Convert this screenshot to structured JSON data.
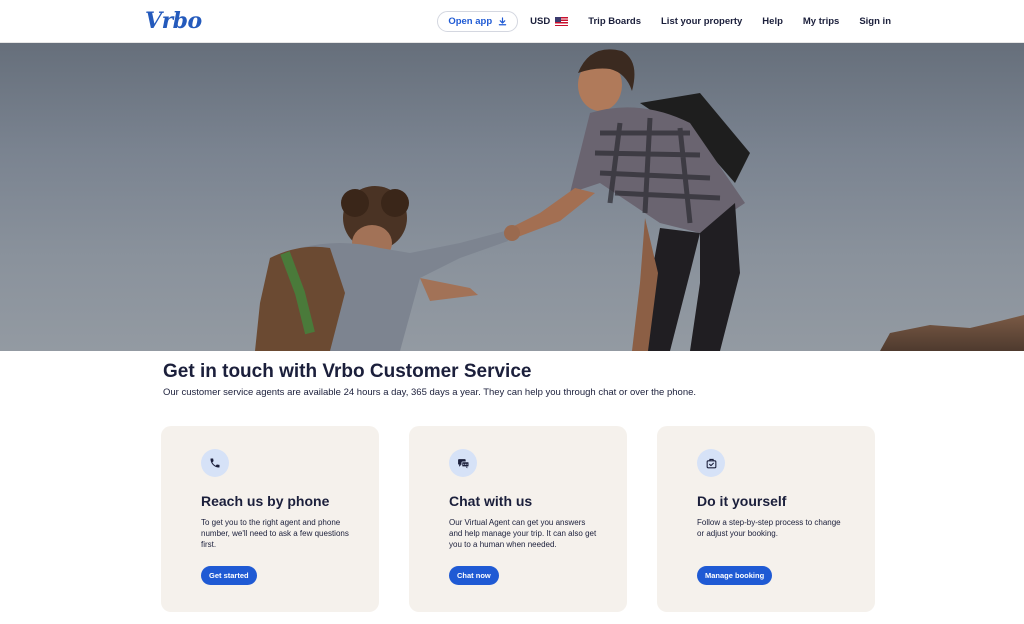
{
  "header": {
    "logo": "Vrbo",
    "open_app": "Open app",
    "currency": "USD",
    "nav": [
      "Trip Boards",
      "List your property",
      "Help",
      "My trips",
      "Sign in"
    ]
  },
  "intro": {
    "title": "Get in touch with Vrbo Customer Service",
    "subtitle": "Our customer service agents are available 24 hours a day, 365 days a year. They can help you through chat or over the phone."
  },
  "cards": [
    {
      "icon": "phone-icon",
      "title": "Reach us by phone",
      "body": "To get you to the right agent and phone number, we'll need to ask a few questions first.",
      "button": "Get started"
    },
    {
      "icon": "chat-icon",
      "title": "Chat with us",
      "body": "Our Virtual Agent can get you answers and help manage your trip. It can also get you to a human when needed.",
      "button": "Chat now"
    },
    {
      "icon": "suitcase-check-icon",
      "title": "Do it yourself",
      "body": "Follow a step-by-step process to change or adjust your booking.",
      "button": "Manage booking"
    }
  ],
  "colors": {
    "accent": "#1f5ad4",
    "card_bg": "#f5f1ec",
    "text": "#1b1f3b",
    "icon_bg": "#d6e2f7"
  }
}
